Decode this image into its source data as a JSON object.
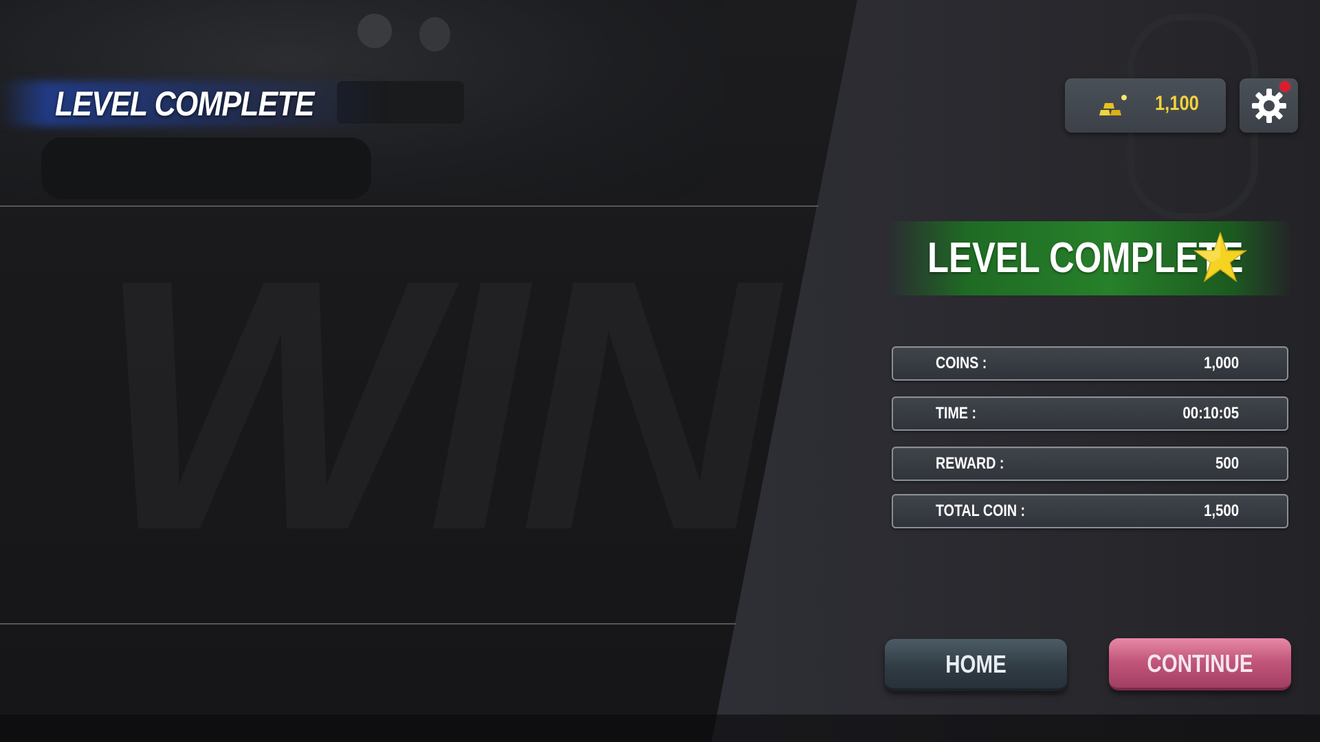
{
  "header": {
    "title": "LEVEL COMPLETE"
  },
  "currency": {
    "icon": "gold-bars-icon",
    "value": "1,100",
    "color": "#f3d23a"
  },
  "settings": {
    "icon": "gear-icon",
    "has_notification": true,
    "notification_color": "#e11a2a"
  },
  "background": {
    "watermark": "WINNER"
  },
  "result": {
    "title": "LEVEL COMPLETE",
    "icon": "star-icon",
    "banner_color": "#27802a",
    "star_color": "#f5d322"
  },
  "stats": [
    {
      "label": "COINS :",
      "value": "1,000"
    },
    {
      "label": "TIME :",
      "value": "00:10:05"
    },
    {
      "label": "REWARD :",
      "value": "500"
    },
    {
      "label": "TOTAL COIN :",
      "value": "1,500"
    }
  ],
  "buttons": {
    "home": "HOME",
    "continue": "CONTINUE",
    "continue_color": "#c3577c"
  }
}
